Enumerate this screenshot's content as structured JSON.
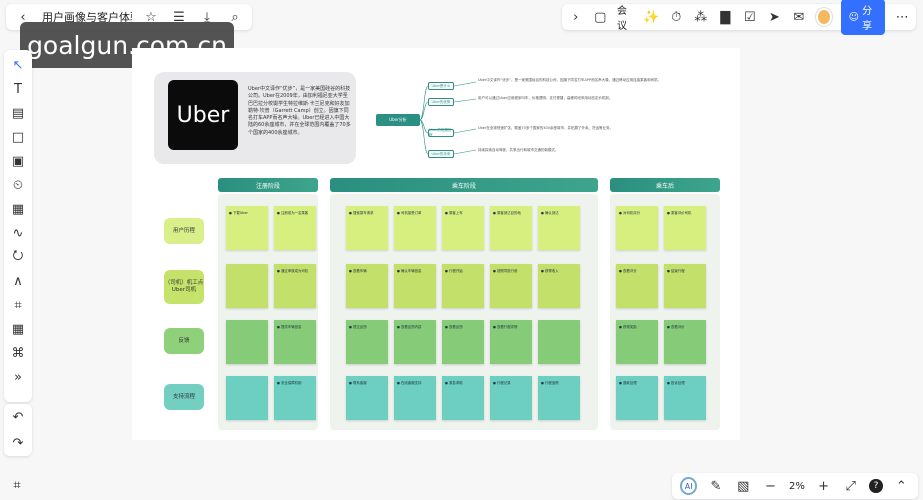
{
  "topbar": {
    "doc_title": "用户画像与客户体验",
    "meeting_label": "会议",
    "share_label": "分享"
  },
  "watermark": "goalgun.com.cn",
  "zoom": "2%",
  "intro": {
    "logo_text": "Uber",
    "description": "Uber中文译作“优步”，是一家美国硅谷的科技公司。Uber在2009年，由加利福尼亚大学圣巴巴拉分校辍学生特拉维斯·卡兰尼克和好友加勒特·坎普（Garrett Camp）创立。因旗下同名打车APP而名声大噪。Uber已经进入中国大陆的60余座城市，并在全球范围内覆盖了70多个国家的400余座城市。"
  },
  "mindmap": {
    "root": "Uber分析",
    "nodes": [
      "Uber是什么",
      "Uber的优势",
      "Uber的发展历程",
      "Uber的未来"
    ],
    "texts": [
      "Uber中文译作“优步”，是一家美国硅谷的科技公司，因旗下同名打车APP而名声大噪，通过移动应用连接乘客和司机。",
      "用户可以通过Uber应用程序叫车，价格透明、支付便捷，高峰时段采用动态定价机制。",
      "Uber在全球快速扩张，覆盖70多个国家的400余座城市，并拓展了外卖、货运等业务。",
      "持续探索自动驾驶、共享出行和城市交通的新模式。"
    ]
  },
  "stages": [
    "注册阶段",
    "乘车阶段",
    "乘车后"
  ],
  "rows": [
    "用户历程",
    "（司机）机工点Uber司机",
    "反馈",
    "支持流程"
  ],
  "notes": {
    "r0": [
      "下载Uber",
      "注册成为一名乘客",
      "搜索乘车请求",
      "司机接受订单",
      "乘客上车",
      "乘客到达目的地",
      "确认到达",
      "对司机评分",
      "乘客评价司机"
    ],
    "r1": [
      "",
      "通过审核成为司机",
      "查看车辆",
      "确认车辆信息",
      "行程开始",
      "按照导航行驶",
      "获得收入",
      "查看评分",
      "结束行程"
    ],
    "r2": [
      "",
      "提供车辆信息",
      "提交反馈",
      "查看反馈内容",
      "查看反馈",
      "查看行程详情",
      "",
      "获得奖励",
      "查看评价"
    ],
    "r3": [
      "",
      "安全保障机制",
      "联系客服",
      "在线客服支持",
      "紧急求助",
      "行程记录",
      "行程追踪",
      "退款处理",
      "投诉处理"
    ]
  }
}
